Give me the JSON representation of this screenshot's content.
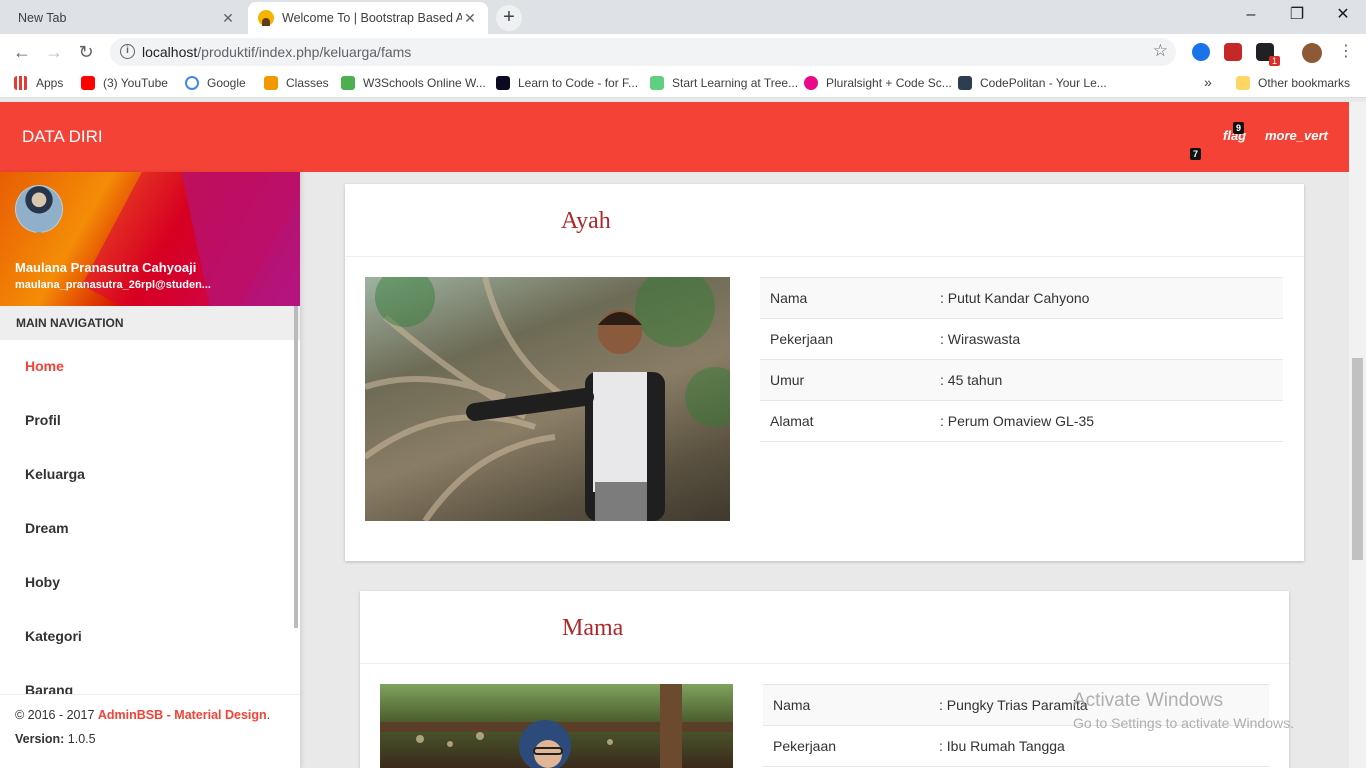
{
  "browser": {
    "tabs": [
      {
        "title": "New Tab"
      },
      {
        "title": "Welcome To | Bootstrap Based Admin Template - Material Design"
      }
    ],
    "new_tab_symbol": "+",
    "window_controls": {
      "minimize": "–",
      "restore": "❐",
      "close": "✕"
    },
    "address": {
      "host": "localhost",
      "path": "/produktif/index.php/keluarga/fams"
    },
    "bookmarks": [
      {
        "label": "Apps",
        "color": "#e53935"
      },
      {
        "label": "(3) YouTube",
        "color": "#ff0000"
      },
      {
        "label": "Google",
        "color": "#4285f4"
      },
      {
        "label": "Classes",
        "color": "#f29900"
      },
      {
        "label": "W3Schools Online W...",
        "color": "#4caf50"
      },
      {
        "label": "Learn to Code - for F...",
        "color": "#0a0a23"
      },
      {
        "label": "Start Learning at Tree...",
        "color": "#5fcf80"
      },
      {
        "label": "Pluralsight + Code Sc...",
        "color": "#e80a89"
      },
      {
        "label": "CodePolitan - Your Le...",
        "color": "#2c3e50"
      }
    ],
    "bookmarks_more": "»",
    "other_bookmarks": "Other bookmarks",
    "extension_badge": "1"
  },
  "topnav": {
    "brand": "DATA DIRI",
    "flag_icon": "flag",
    "flag_badge": "9",
    "more_icon": "more_vert",
    "notif_badge": "7",
    "accent": "#f44336"
  },
  "sidebar": {
    "user_name": "Maulana Pranasutra Cahyoaji",
    "user_email": "maulana_pranasutra_26rpl@studen...",
    "menu_header": "MAIN NAVIGATION",
    "items": [
      {
        "label": "Home",
        "active": true
      },
      {
        "label": "Profil"
      },
      {
        "label": "Keluarga"
      },
      {
        "label": "Dream"
      },
      {
        "label": "Hoby"
      },
      {
        "label": "Kategori"
      },
      {
        "label": "Barang"
      }
    ],
    "legal": {
      "copyright_prefix": "© 2016 - 2017 ",
      "copyright_link": "AdminBSB - Material Design",
      "copyright_suffix": ".",
      "version_label": "Version:",
      "version_value": " 1.0.5"
    }
  },
  "family": [
    {
      "title": "Ayah",
      "rows": [
        {
          "label": "Nama",
          "value": ": Putut Kandar Cahyono"
        },
        {
          "label": "Pekerjaan",
          "value": ": Wiraswasta"
        },
        {
          "label": "Umur",
          "value": ": 45 tahun"
        },
        {
          "label": "Alamat",
          "value": ": Perum Omaview GL-35"
        }
      ]
    },
    {
      "title": "Mama",
      "rows": [
        {
          "label": "Nama",
          "value": ": Pungky Trias Paramita"
        },
        {
          "label": "Pekerjaan",
          "value": ": Ibu Rumah Tangga"
        }
      ]
    }
  ],
  "watermark": {
    "line1": "Activate Windows",
    "line2": "Go to Settings to activate Windows."
  }
}
